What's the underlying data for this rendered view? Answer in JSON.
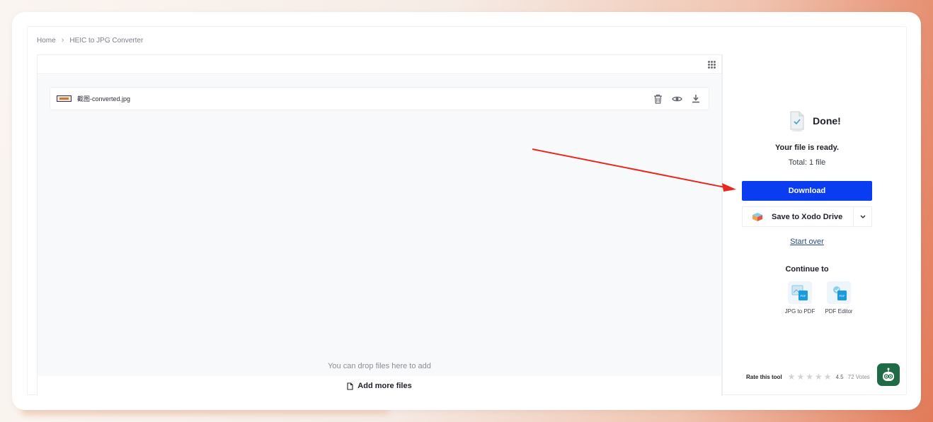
{
  "breadcrumb": {
    "home": "Home",
    "separator": "›",
    "current": "HEIC to JPG Converter"
  },
  "file": {
    "name": "截图-converted.jpg"
  },
  "workspace": {
    "drop_hint": "You can drop files here to add",
    "add_more_label": "Add more files"
  },
  "result": {
    "done_title": "Done!",
    "ready_text": "Your file is ready.",
    "total_text": "Total: 1 file",
    "download_label": "Download",
    "save_drive_label": "Save to Xodo Drive",
    "start_over_label": "Start over"
  },
  "continue_to": {
    "heading": "Continue to",
    "tools": [
      {
        "label": "JPG to PDF",
        "icon": "jpg-to-pdf-icon"
      },
      {
        "label": "PDF Editor",
        "icon": "pdf-editor-icon"
      }
    ]
  },
  "rating": {
    "label": "Rate this tool",
    "score": "4.5",
    "votes": "72 Votes",
    "stars": 5
  },
  "colors": {
    "accent": "#0a3cf2",
    "annotation_arrow": "#e8281f",
    "bot": "#1e6b45"
  }
}
